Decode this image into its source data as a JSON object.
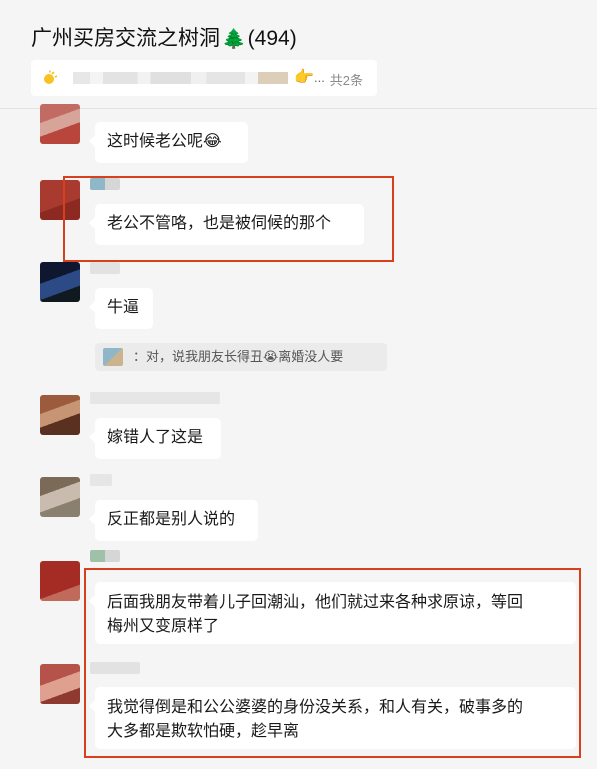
{
  "chat": {
    "title": "广州买房交流之树洞",
    "tree_emoji": "🌲",
    "member_count": "(494)",
    "pinned": {
      "hand_emoji": "👉",
      "ellipsis": "...",
      "count_label": "共2条"
    }
  },
  "messages": [
    {
      "text": "这时候老公呢",
      "emoji": "😂"
    },
    {
      "text": "老公不管咯，也是被伺候的那个"
    },
    {
      "text": "牛逼",
      "quote": {
        "before": "：对，说我朋友长得丑",
        "emoji": "😭",
        "after": "离婚没人要"
      }
    },
    {
      "text": "嫁错人了这是"
    },
    {
      "text": "反正都是别人说的"
    },
    {
      "line1": "后面我朋友带着儿子回潮汕，他们就过来各种求原谅，等回",
      "line2": "梅州又变原样了"
    },
    {
      "line1": "我觉得倒是和公公婆婆的身份没关系，和人有关，破事多的",
      "line2": "大多都是欺软怕硬，趁早离"
    }
  ],
  "colors": {
    "highlight_box": "#d7401f",
    "background": "#f5f5f5",
    "bubble": "#ffffff"
  }
}
